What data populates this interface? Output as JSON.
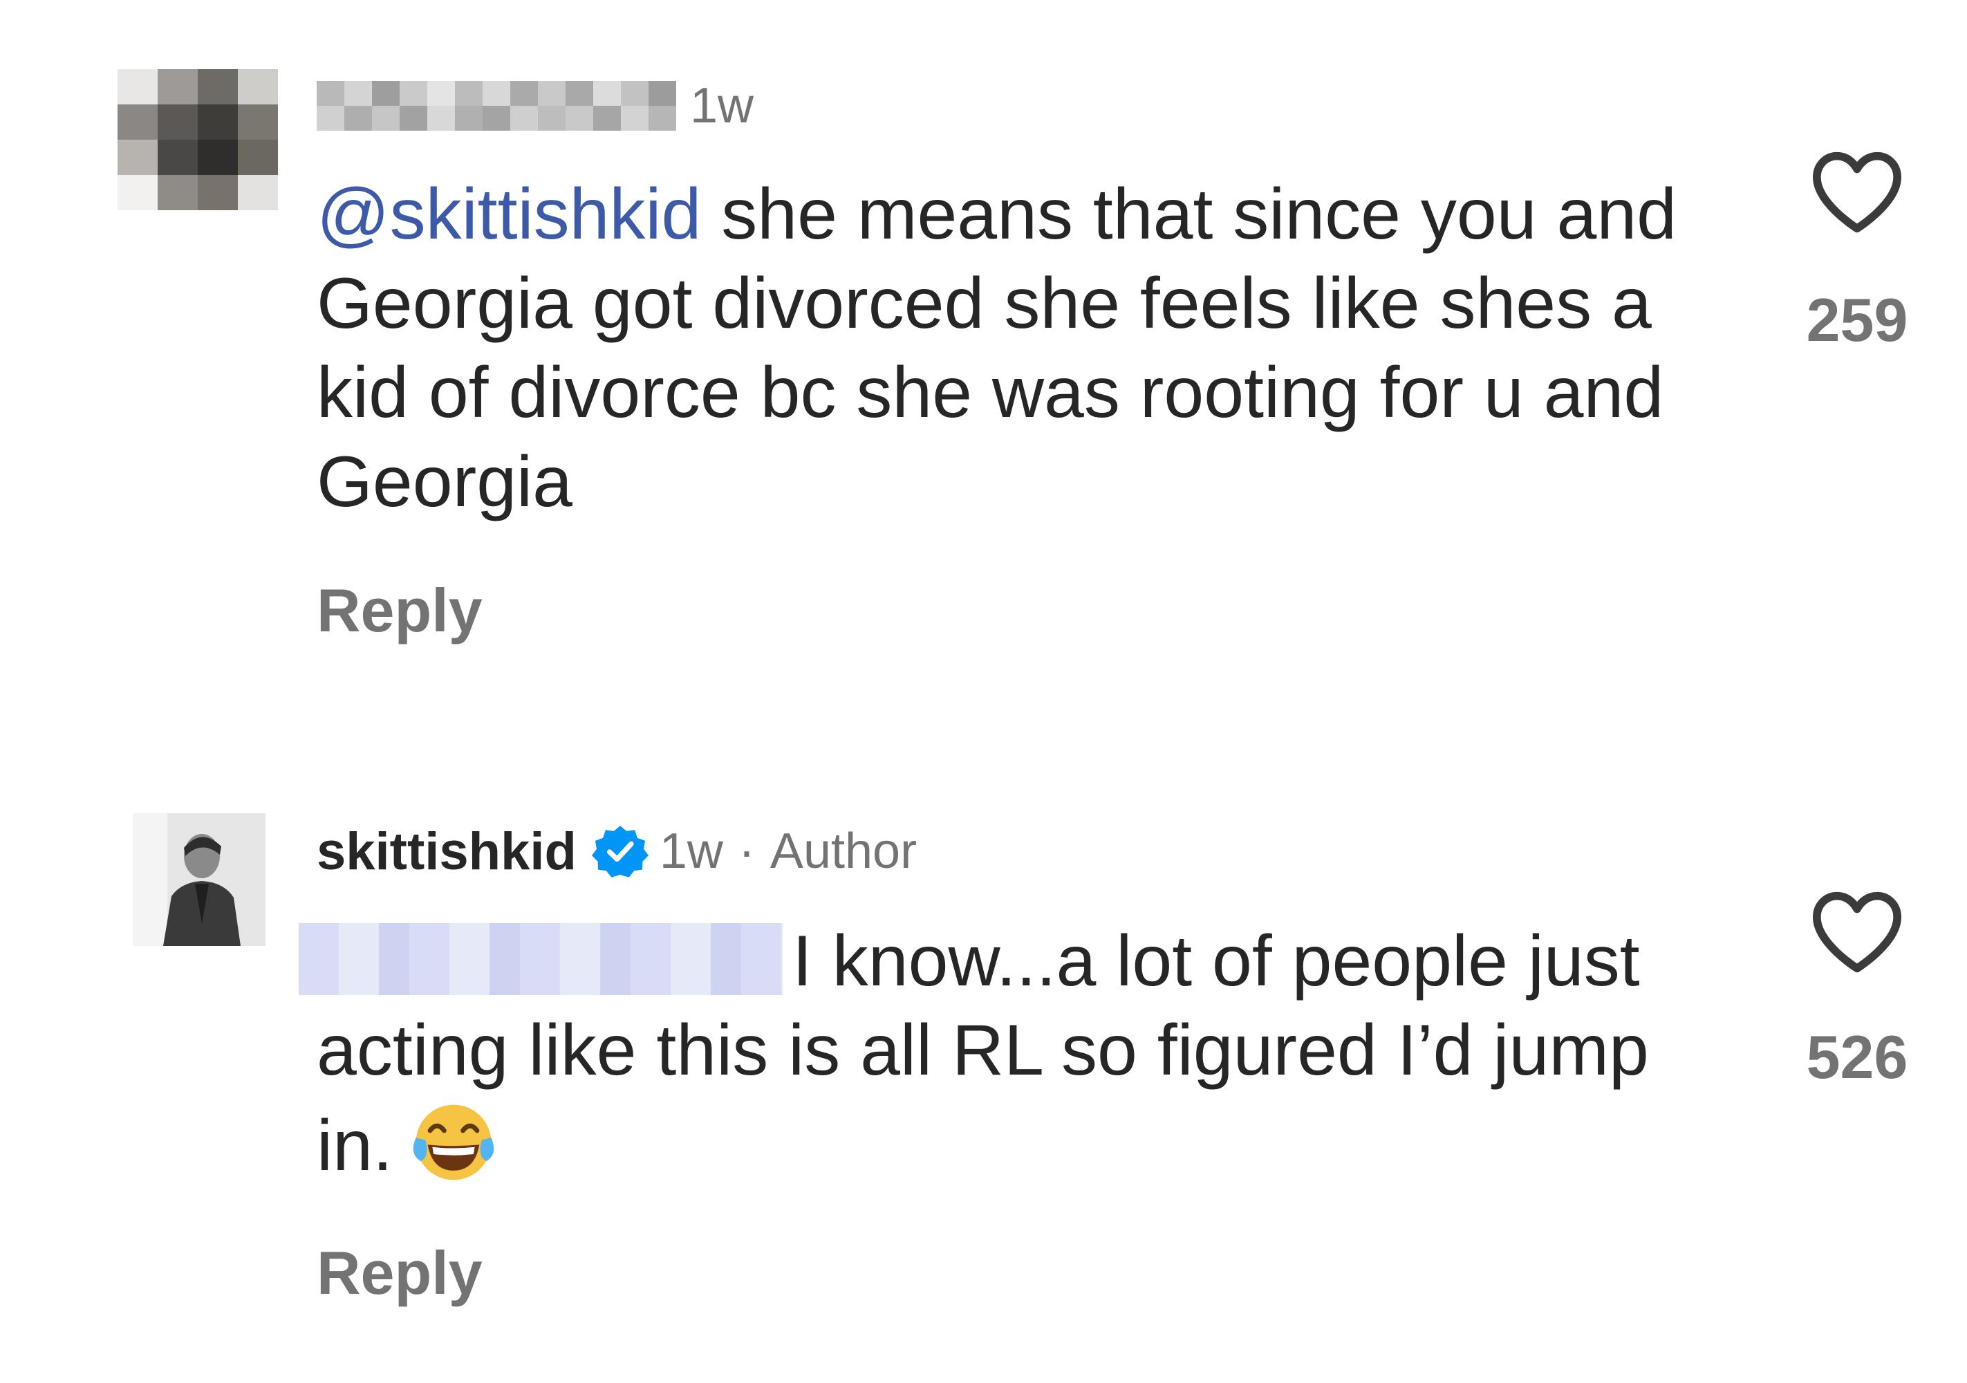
{
  "comments": [
    {
      "username": "",
      "time": "1w",
      "mention": "@skittishkid",
      "text": " she means that since you and Georgia got divorced she feels like shes a kid of divorce bc she was rooting for u and Georgia",
      "reply_label": "Reply",
      "likes": "259",
      "like_icon": "heart-outline-icon"
    },
    {
      "username": "skittishkid",
      "verified_icon": "verified-badge-icon",
      "time": "1w",
      "separator": "·",
      "author_label": "Author",
      "text": "I know...a lot of people just acting like this is all RL so figured I’d jump in.",
      "emoji": "face-with-tears-of-joy-icon",
      "reply_label": "Reply",
      "likes": "526",
      "like_icon": "heart-outline-icon"
    }
  ],
  "colors": {
    "text": "#262626",
    "secondary": "#737373",
    "mention": "#3d5aa8",
    "verified": "#0095f6"
  }
}
